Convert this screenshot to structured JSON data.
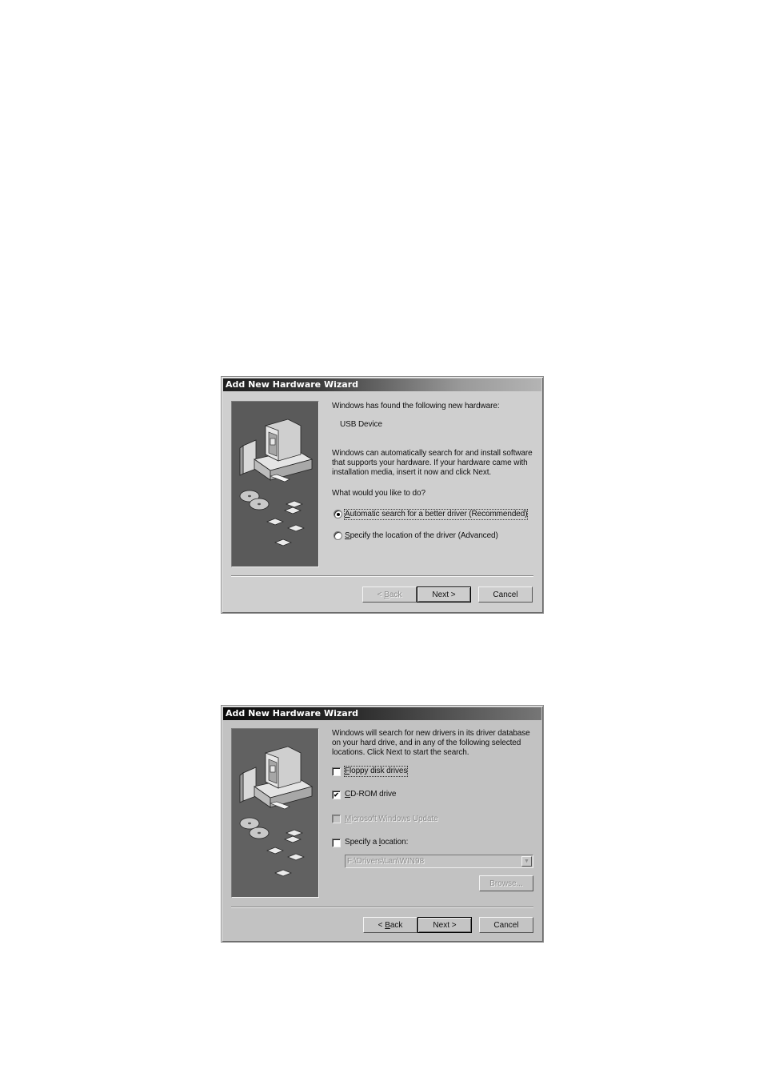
{
  "dialogs": [
    {
      "title": "Add New Hardware Wizard",
      "intro": "Windows has found the following new hardware:",
      "device": "USB Device",
      "description": [
        "Windows can automatically search for and install software",
        "that supports your hardware. If your hardware came with",
        "installation media, insert it now and click Next."
      ],
      "question": "What would you like to do?",
      "options": [
        {
          "mnemonic": "A",
          "rest": "utomatic search for a better driver (Recommended)",
          "selected": true
        },
        {
          "mnemonic": "S",
          "rest": "pecify the location of the driver (Advanced)",
          "selected": false
        }
      ],
      "buttons": {
        "back": {
          "prefix": "< ",
          "mnemonic": "B",
          "rest": "ack",
          "enabled": false
        },
        "next": "Next >",
        "cancel": "Cancel"
      }
    },
    {
      "title": "Add New Hardware Wizard",
      "description": [
        "Windows will search for new drivers in its driver database",
        "on your hard drive, and in any of the following selected",
        "locations. Click Next to start the search."
      ],
      "checkboxes": [
        {
          "mnemonic": "F",
          "rest": "loppy disk drives",
          "checked": false,
          "enabled": true
        },
        {
          "mnemonic": "C",
          "rest": "D-ROM drive",
          "checked": true,
          "enabled": true
        },
        {
          "mnemonic": "M",
          "rest": "icrosoft Windows Update",
          "checked": false,
          "enabled": false
        },
        {
          "prefix": "Specify a ",
          "mnemonic": "l",
          "rest": "ocation:",
          "checked": false,
          "enabled": true
        }
      ],
      "location_value": "F:\\Drivers\\Lan\\WIN98",
      "browse_label": "Browse...",
      "buttons": {
        "back": {
          "prefix": "< ",
          "mnemonic": "B",
          "rest": "ack",
          "enabled": true
        },
        "next": "Next >",
        "cancel": "Cancel"
      }
    }
  ],
  "icons": {
    "checkmark": "✔",
    "dropdown_arrow": "▼"
  }
}
